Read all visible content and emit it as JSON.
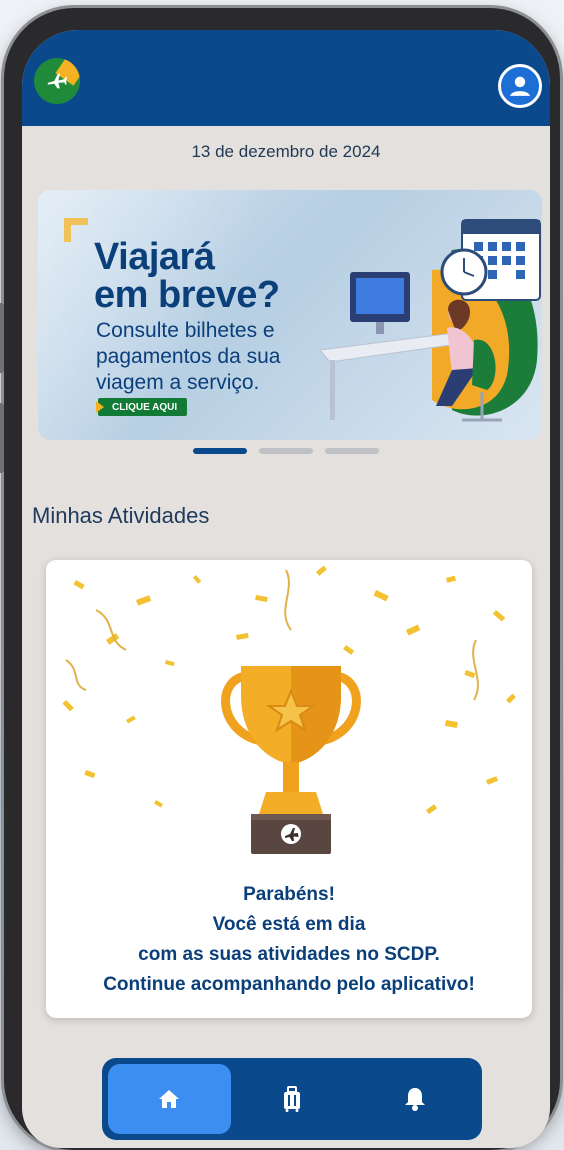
{
  "header": {
    "logo_icon": "airplane-logo-icon",
    "avatar_icon": "user-avatar-icon",
    "brand_color": "#0a4a8c"
  },
  "date_text": "13 de dezembro de 2024",
  "banner": {
    "title_line1": "Viajará",
    "title_line2": "em breve?",
    "body": "Consulte bilhetes e pagamentos da sua viagem a serviço.",
    "cta_label": "CLIQUE AQUI",
    "page_count": 3,
    "active_page": 1
  },
  "activities": {
    "section_title": "Minhas Atividades",
    "message_line1": "Parabéns!",
    "message_line2": "Você está em dia",
    "message_line3": "com as suas atividades no SCDP.",
    "message_line4": "Continue acompanhando pelo aplicativo!",
    "trophy_icon": "trophy-icon"
  },
  "bottom_nav": {
    "items": [
      {
        "icon": "home-icon",
        "active": true
      },
      {
        "icon": "luggage-icon",
        "active": false
      },
      {
        "icon": "bell-icon",
        "active": false
      }
    ]
  }
}
